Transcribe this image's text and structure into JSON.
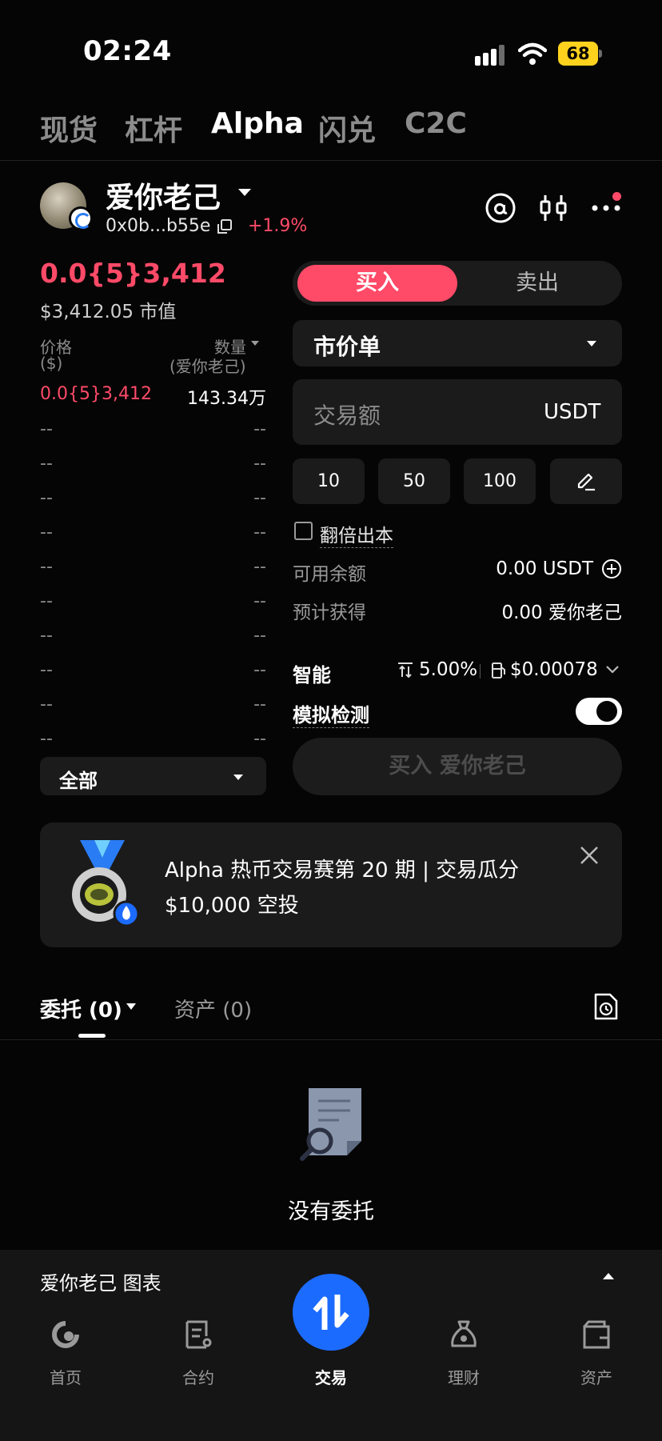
{
  "status_bar": {
    "time": "02:24",
    "battery": "68"
  },
  "top_tabs": [
    {
      "label": "现货"
    },
    {
      "label": "杠杆"
    },
    {
      "label": "Alpha"
    },
    {
      "label": "闪兑"
    },
    {
      "label": "C2C"
    }
  ],
  "token": {
    "name": "爱你老己",
    "address": "0x0b...b55e",
    "change": "+1.9%",
    "price": "0.0{5}3,412",
    "market_cap": "$3,412.05 市值"
  },
  "order_book": {
    "price_header": "价格",
    "price_unit": "($)",
    "qty_header": "数量",
    "qty_unit": "(爱你老己)",
    "first_row": {
      "price": "0.0{5}3,412",
      "qty": "143.34万"
    },
    "empty_rows": [
      {
        "price": "--",
        "qty": "--"
      },
      {
        "price": "--",
        "qty": "--"
      },
      {
        "price": "--",
        "qty": "--"
      },
      {
        "price": "--",
        "qty": "--"
      },
      {
        "price": "--",
        "qty": "--"
      },
      {
        "price": "--",
        "qty": "--"
      },
      {
        "price": "--",
        "qty": "--"
      },
      {
        "price": "--",
        "qty": "--"
      },
      {
        "price": "--",
        "qty": "--"
      },
      {
        "price": "--",
        "qty": "--"
      }
    ],
    "filter": "全部"
  },
  "trade": {
    "buy_label": "买入",
    "sell_label": "卖出",
    "order_type": "市价单",
    "amount_placeholder": "交易额",
    "amount_unit": "USDT",
    "quick_amounts": [
      "10",
      "50",
      "100"
    ],
    "double_principal": "翻倍出本",
    "available_label": "可用余额",
    "available_value": "0.00 USDT",
    "estimate_label": "预计获得",
    "estimate_value": "0.00 爱你老己",
    "smart_label": "智能",
    "slippage": "5.00%",
    "gas": "$0.00078",
    "simulate_label": "模拟检测",
    "simulate_on": true,
    "submit_label": "买入 爱你老己"
  },
  "banner": {
    "text": "Alpha 热币交易赛第 20 期 | 交易瓜分 $10,000 空投"
  },
  "orders": {
    "tab_orders": "委托 (0)",
    "tab_assets": "资产 (0)",
    "empty_text": "没有委托"
  },
  "chart_bar": {
    "label": "爱你老己 图表"
  },
  "bottom_nav": [
    {
      "label": "首页",
      "icon": "home-icon"
    },
    {
      "label": "合约",
      "icon": "contract-icon"
    },
    {
      "label": "交易",
      "icon": "trade-icon"
    },
    {
      "label": "理财",
      "icon": "finance-icon"
    },
    {
      "label": "资产",
      "icon": "wallet-icon"
    }
  ],
  "colors": {
    "accent_red": "#ff4a68",
    "primary_blue": "#1c6bff",
    "background": "#050505"
  }
}
